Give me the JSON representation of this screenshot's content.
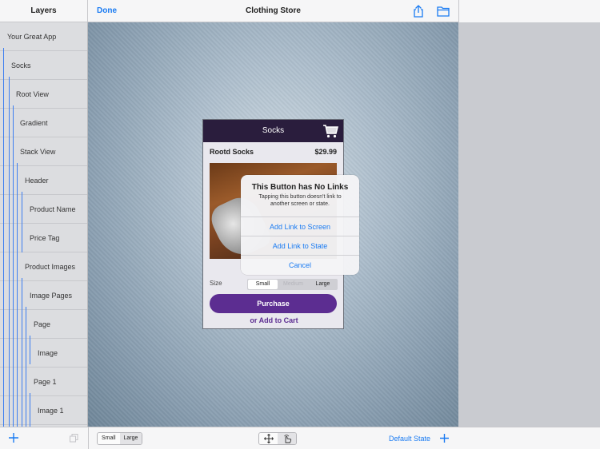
{
  "topbar": {
    "layers_title": "Layers",
    "done_label": "Done",
    "app_title": "Clothing Store"
  },
  "icons": {
    "share": "share-icon",
    "folder": "folder-icon",
    "cart": "cart-icon",
    "plus": "plus-icon",
    "duplicate": "duplicate-icon",
    "move": "move-icon",
    "hand": "hand-pointer-icon"
  },
  "sidebar": {
    "items": [
      {
        "label": "Your Great App"
      },
      {
        "label": "Socks"
      },
      {
        "label": "Root View"
      },
      {
        "label": "Gradient"
      },
      {
        "label": "Stack View"
      },
      {
        "label": "Header"
      },
      {
        "label": "Product Name"
      },
      {
        "label": "Price Tag"
      },
      {
        "label": "Product Images"
      },
      {
        "label": "Image Pages"
      },
      {
        "label": "Page"
      },
      {
        "label": "Image"
      },
      {
        "label": "Page 1"
      },
      {
        "label": "Image 1"
      }
    ]
  },
  "preview": {
    "header_title": "Socks",
    "product_name": "Rootd Socks",
    "product_price": "$29.99",
    "size_label": "Size",
    "size_options": [
      "Small",
      "Medium",
      "Large"
    ],
    "purchase_label": "Purchase",
    "add_cart_label": "or Add to Cart"
  },
  "alert": {
    "title": "This Button has No Links",
    "message": "Tapping this button doesn't link to another screen or state.",
    "buttons": [
      "Add Link to Screen",
      "Add Link to State",
      "Cancel"
    ]
  },
  "bottombar": {
    "size_options": [
      "Small",
      "Large"
    ],
    "state_label": "Default State"
  },
  "colors": {
    "accent": "#1a7bf2",
    "brand_purple": "#5c2d91",
    "header_dark": "#2a1d3d",
    "layer_line": "#3d7ef0"
  }
}
